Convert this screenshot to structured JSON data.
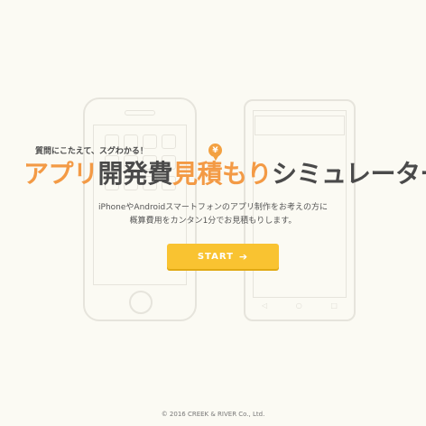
{
  "hero": {
    "catchphrase": "質問にこたえて、スグわかる！",
    "yen_symbol": "¥",
    "title_parts": {
      "p1": "アプリ",
      "p2": "開発費",
      "p3": "見積もり",
      "p4": "シミュレーター"
    },
    "description_line1": "iPhoneやAndroidスマートフォンのアプリ制作をお考えの方に",
    "description_line2": "概算費用をカンタン1分でお見積もりします。",
    "start_label": "START",
    "start_arrow": "➔"
  },
  "android_nav": {
    "back": "◁",
    "home": "○",
    "recent": "□"
  },
  "footer": {
    "copyright": "© 2016 CREEK & RIVER Co., Ltd."
  },
  "colors": {
    "accent_orange": "#f39a45",
    "button_yellow": "#f9c331",
    "background": "#fbfaf3"
  }
}
